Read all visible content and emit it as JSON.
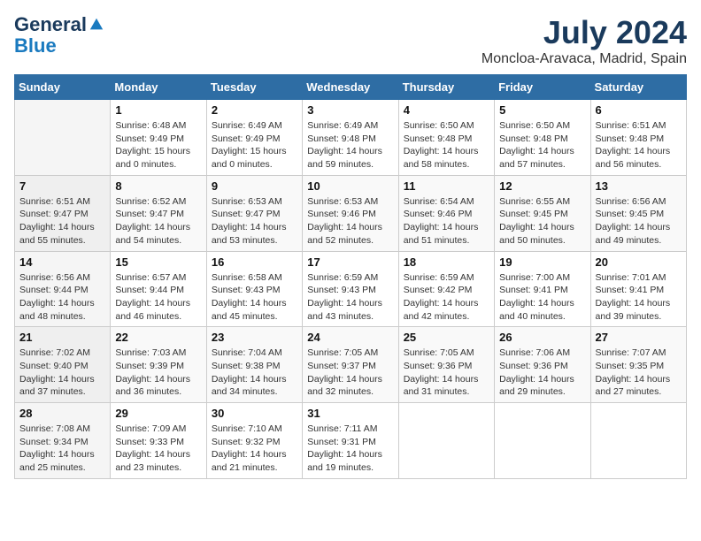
{
  "header": {
    "logo_line1": "General",
    "logo_line2": "Blue",
    "title": "July 2024",
    "subtitle": "Moncloa-Aravaca, Madrid, Spain"
  },
  "columns": [
    "Sunday",
    "Monday",
    "Tuesday",
    "Wednesday",
    "Thursday",
    "Friday",
    "Saturday"
  ],
  "weeks": [
    [
      {
        "day": "",
        "sunrise": "",
        "sunset": "",
        "daylight": ""
      },
      {
        "day": "1",
        "sunrise": "6:48 AM",
        "sunset": "9:49 PM",
        "daylight": "15 hours and 0 minutes."
      },
      {
        "day": "2",
        "sunrise": "6:49 AM",
        "sunset": "9:49 PM",
        "daylight": "15 hours and 0 minutes."
      },
      {
        "day": "3",
        "sunrise": "6:49 AM",
        "sunset": "9:48 PM",
        "daylight": "14 hours and 59 minutes."
      },
      {
        "day": "4",
        "sunrise": "6:50 AM",
        "sunset": "9:48 PM",
        "daylight": "14 hours and 58 minutes."
      },
      {
        "day": "5",
        "sunrise": "6:50 AM",
        "sunset": "9:48 PM",
        "daylight": "14 hours and 57 minutes."
      },
      {
        "day": "6",
        "sunrise": "6:51 AM",
        "sunset": "9:48 PM",
        "daylight": "14 hours and 56 minutes."
      }
    ],
    [
      {
        "day": "7",
        "sunrise": "6:51 AM",
        "sunset": "9:47 PM",
        "daylight": "14 hours and 55 minutes."
      },
      {
        "day": "8",
        "sunrise": "6:52 AM",
        "sunset": "9:47 PM",
        "daylight": "14 hours and 54 minutes."
      },
      {
        "day": "9",
        "sunrise": "6:53 AM",
        "sunset": "9:47 PM",
        "daylight": "14 hours and 53 minutes."
      },
      {
        "day": "10",
        "sunrise": "6:53 AM",
        "sunset": "9:46 PM",
        "daylight": "14 hours and 52 minutes."
      },
      {
        "day": "11",
        "sunrise": "6:54 AM",
        "sunset": "9:46 PM",
        "daylight": "14 hours and 51 minutes."
      },
      {
        "day": "12",
        "sunrise": "6:55 AM",
        "sunset": "9:45 PM",
        "daylight": "14 hours and 50 minutes."
      },
      {
        "day": "13",
        "sunrise": "6:56 AM",
        "sunset": "9:45 PM",
        "daylight": "14 hours and 49 minutes."
      }
    ],
    [
      {
        "day": "14",
        "sunrise": "6:56 AM",
        "sunset": "9:44 PM",
        "daylight": "14 hours and 48 minutes."
      },
      {
        "day": "15",
        "sunrise": "6:57 AM",
        "sunset": "9:44 PM",
        "daylight": "14 hours and 46 minutes."
      },
      {
        "day": "16",
        "sunrise": "6:58 AM",
        "sunset": "9:43 PM",
        "daylight": "14 hours and 45 minutes."
      },
      {
        "day": "17",
        "sunrise": "6:59 AM",
        "sunset": "9:43 PM",
        "daylight": "14 hours and 43 minutes."
      },
      {
        "day": "18",
        "sunrise": "6:59 AM",
        "sunset": "9:42 PM",
        "daylight": "14 hours and 42 minutes."
      },
      {
        "day": "19",
        "sunrise": "7:00 AM",
        "sunset": "9:41 PM",
        "daylight": "14 hours and 40 minutes."
      },
      {
        "day": "20",
        "sunrise": "7:01 AM",
        "sunset": "9:41 PM",
        "daylight": "14 hours and 39 minutes."
      }
    ],
    [
      {
        "day": "21",
        "sunrise": "7:02 AM",
        "sunset": "9:40 PM",
        "daylight": "14 hours and 37 minutes."
      },
      {
        "day": "22",
        "sunrise": "7:03 AM",
        "sunset": "9:39 PM",
        "daylight": "14 hours and 36 minutes."
      },
      {
        "day": "23",
        "sunrise": "7:04 AM",
        "sunset": "9:38 PM",
        "daylight": "14 hours and 34 minutes."
      },
      {
        "day": "24",
        "sunrise": "7:05 AM",
        "sunset": "9:37 PM",
        "daylight": "14 hours and 32 minutes."
      },
      {
        "day": "25",
        "sunrise": "7:05 AM",
        "sunset": "9:36 PM",
        "daylight": "14 hours and 31 minutes."
      },
      {
        "day": "26",
        "sunrise": "7:06 AM",
        "sunset": "9:36 PM",
        "daylight": "14 hours and 29 minutes."
      },
      {
        "day": "27",
        "sunrise": "7:07 AM",
        "sunset": "9:35 PM",
        "daylight": "14 hours and 27 minutes."
      }
    ],
    [
      {
        "day": "28",
        "sunrise": "7:08 AM",
        "sunset": "9:34 PM",
        "daylight": "14 hours and 25 minutes."
      },
      {
        "day": "29",
        "sunrise": "7:09 AM",
        "sunset": "9:33 PM",
        "daylight": "14 hours and 23 minutes."
      },
      {
        "day": "30",
        "sunrise": "7:10 AM",
        "sunset": "9:32 PM",
        "daylight": "14 hours and 21 minutes."
      },
      {
        "day": "31",
        "sunrise": "7:11 AM",
        "sunset": "9:31 PM",
        "daylight": "14 hours and 19 minutes."
      },
      {
        "day": "",
        "sunrise": "",
        "sunset": "",
        "daylight": ""
      },
      {
        "day": "",
        "sunrise": "",
        "sunset": "",
        "daylight": ""
      },
      {
        "day": "",
        "sunrise": "",
        "sunset": "",
        "daylight": ""
      }
    ]
  ],
  "labels": {
    "sunrise_prefix": "Sunrise: ",
    "sunset_prefix": "Sunset: ",
    "daylight_prefix": "Daylight: "
  }
}
